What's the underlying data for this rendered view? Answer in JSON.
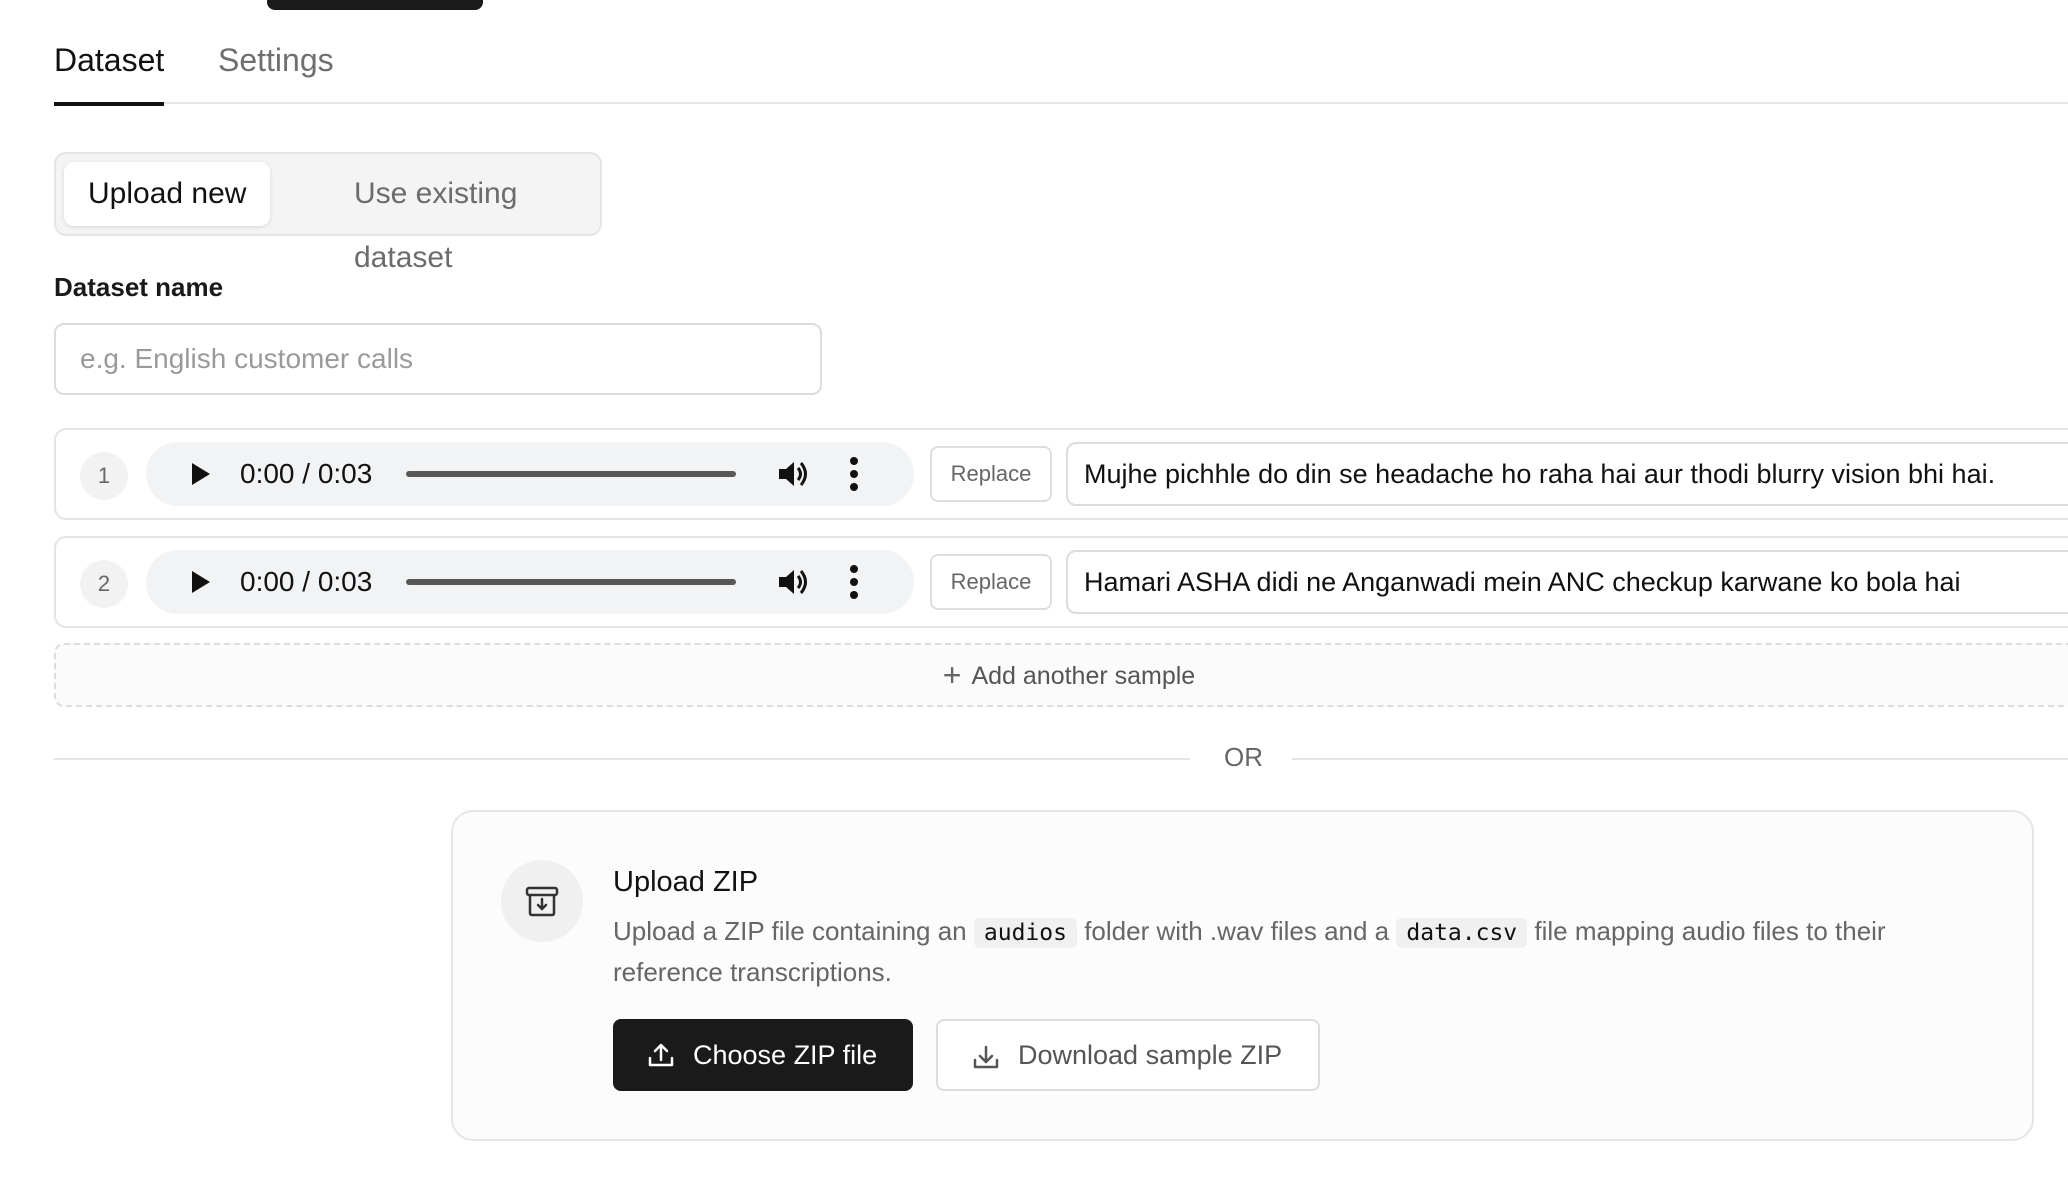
{
  "tabs": [
    {
      "label": "Dataset",
      "active": true
    },
    {
      "label": "Settings",
      "active": false
    }
  ],
  "source_toggle": {
    "options": [
      "Upload new",
      "Use existing dataset"
    ],
    "selected": "Upload new"
  },
  "dataset_name": {
    "label": "Dataset name",
    "placeholder": "e.g. English customer calls",
    "value": ""
  },
  "samples": [
    {
      "index": "1",
      "time": "0:00 / 0:03",
      "replace_label": "Replace",
      "transcript": "Mujhe pichhle do din se headache ho raha hai aur thodi blurry vision bhi hai."
    },
    {
      "index": "2",
      "time": "0:00 / 0:03",
      "replace_label": "Replace",
      "transcript": "Hamari ASHA didi ne Anganwadi mein ANC checkup karwane ko bola hai"
    }
  ],
  "add_sample_label": "Add another sample",
  "divider_label": "OR",
  "zip_upload": {
    "title": "Upload ZIP",
    "desc_part1": "Upload a ZIP file containing an",
    "code1": "audios",
    "desc_part2": "folder with .wav files and a",
    "code2": "data.csv",
    "desc_part3": "file mapping audio files to their reference transcriptions.",
    "choose_label": "Choose ZIP file",
    "download_label": "Download sample ZIP"
  },
  "icons": {
    "play": "play-icon",
    "volume": "volume-icon",
    "more": "more-vertical-icon",
    "plus": "plus-icon",
    "archive": "archive-download-icon",
    "upload": "upload-icon",
    "download": "download-icon"
  },
  "colors": {
    "primary_button": "#1a1a1a",
    "player_bg": "#f1f3f4",
    "border": "#e4e4e4"
  }
}
